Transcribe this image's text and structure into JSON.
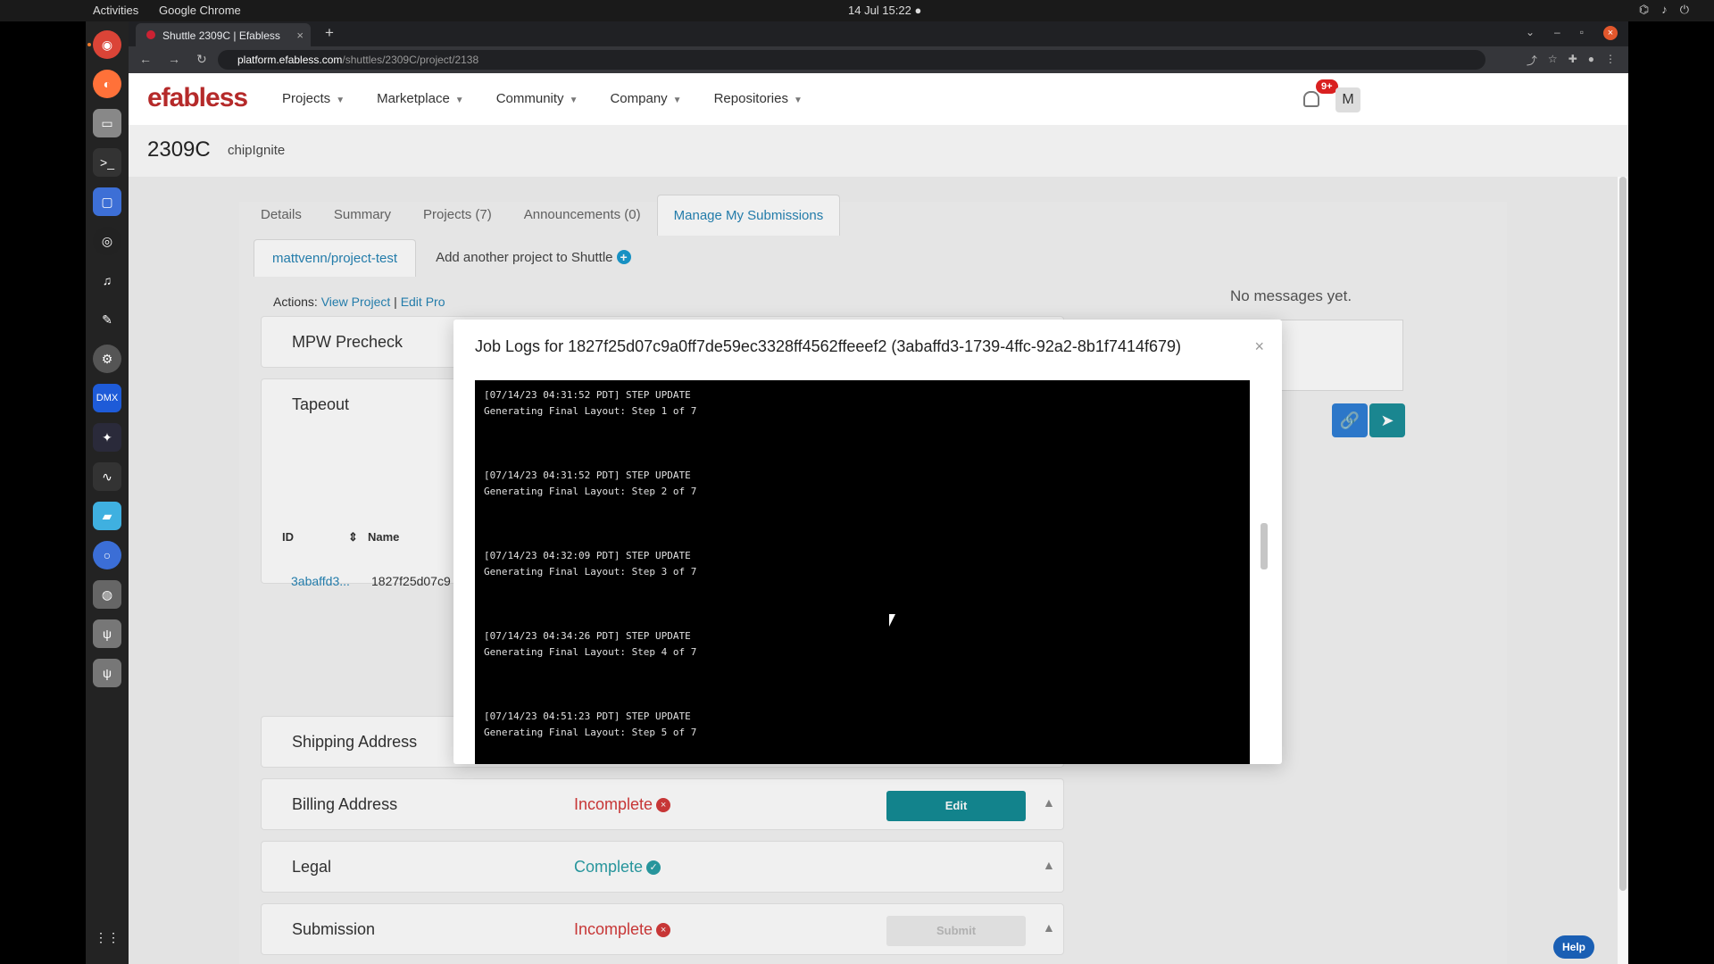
{
  "system": {
    "activities": "Activities",
    "app_name": "Google Chrome",
    "clock": "14 Jul  15:22  ●"
  },
  "browser": {
    "tab_title": "Shuttle 2309C | Efabless",
    "url_host": "platform.efabless.com",
    "url_path": "/shuttles/2309C/project/2138"
  },
  "site": {
    "logo": "efabless",
    "nav": [
      "Projects",
      "Marketplace",
      "Community",
      "Company",
      "Repositories"
    ],
    "notification_count": "9+",
    "avatar_initial": "M"
  },
  "shuttle": {
    "id": "2309C",
    "name": "chipIgnite"
  },
  "tabs": [
    "Details",
    "Summary",
    "Projects (7)",
    "Announcements (0)",
    "Manage My Submissions"
  ],
  "subtabs": {
    "project": "mattvenn/project-test",
    "add_project": "Add another project to Shuttle"
  },
  "actions": {
    "label": "Actions:",
    "view_project": "View Project",
    "sep": "|",
    "edit_project": "Edit Pro"
  },
  "sections": {
    "mpw_precheck": "MPW Precheck",
    "tapeout": "Tapeout",
    "shipping": "Shipping Address",
    "billing": {
      "title": "Billing Address",
      "status": "Incomplete",
      "button": "Edit"
    },
    "legal": {
      "title": "Legal",
      "status": "Complete"
    },
    "submission": {
      "title": "Submission",
      "status": "Incomplete",
      "button": "Submit"
    }
  },
  "table": {
    "col_id": "ID",
    "col_name": "Name",
    "row_id": "3abaffd3...",
    "row_name": "1827f25d07c9"
  },
  "messages": {
    "empty": "No messages yet."
  },
  "modal": {
    "title": "Job Logs for 1827f25d07c9a0ff7de59ec3328ff4562ffeeef2 (3abaffd3-1739-4ffc-92a2-8b1f7414f679)",
    "logs": [
      {
        "stamp": "[07/14/23 04:31:52 PDT] STEP UPDATE",
        "msg": "Generating Final Layout: Step 1 of 7"
      },
      {
        "stamp": "[07/14/23 04:31:52 PDT] STEP UPDATE",
        "msg": "Generating Final Layout: Step 2 of 7"
      },
      {
        "stamp": "[07/14/23 04:32:09 PDT] STEP UPDATE",
        "msg": "Generating Final Layout: Step 3 of 7"
      },
      {
        "stamp": "[07/14/23 04:34:26 PDT] STEP UPDATE",
        "msg": "Generating Final Layout: Step 4 of 7"
      },
      {
        "stamp": "[07/14/23 04:51:23 PDT] STEP UPDATE",
        "msg": "Generating Final Layout: Step 5 of 7"
      }
    ]
  },
  "help": "Help",
  "colors": {
    "brand": "#b52a2a",
    "link": "#2684b5",
    "incomplete": "#d43a3a",
    "complete": "#2a9fa6",
    "edit_button": "#148c95"
  }
}
